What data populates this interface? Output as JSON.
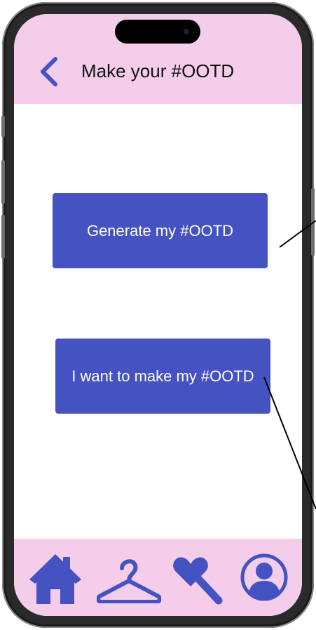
{
  "header": {
    "title": "Make your #OOTD",
    "back_icon": "chevron-left-icon"
  },
  "main": {
    "generate_button": "Generate my #OOTD",
    "make_button": "I want to make my #OOTD"
  },
  "navbar": {
    "items": [
      {
        "icon": "home-icon"
      },
      {
        "icon": "hanger-icon"
      },
      {
        "icon": "heart-wand-icon"
      },
      {
        "icon": "profile-icon"
      }
    ]
  },
  "colors": {
    "accent": "#4552c1",
    "header_bg": "#f4cdea",
    "screen_bg": "#ffffff",
    "text": "#111111"
  }
}
